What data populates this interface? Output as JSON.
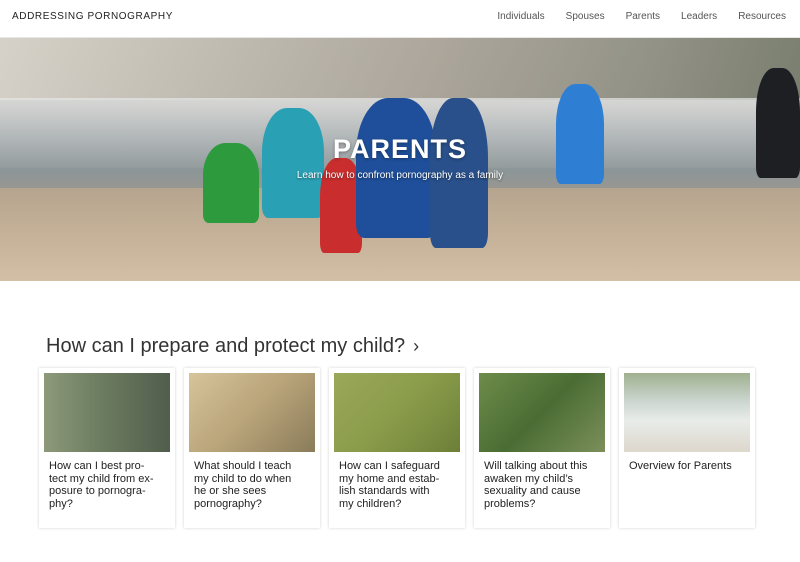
{
  "header": {
    "brand": "ADDRESSING PORNOGRAPHY",
    "nav": [
      "Individuals",
      "Spouses",
      "Parents",
      "Leaders",
      "Resources"
    ]
  },
  "hero": {
    "title": "PARENTS",
    "subtitle": "Learn how to confront pornography as a family"
  },
  "section": {
    "title": "How can I prepare and protect my child?"
  },
  "cards": [
    {
      "caption": "How can I best pro-\ntect my child from ex-\nposure to pornogra-\nphy?"
    },
    {
      "caption": "What should I teach\nmy child to do when\nhe or she sees\npornography?"
    },
    {
      "caption": "How can I safeguard\nmy home and estab-\nlish standards with\nmy children?"
    },
    {
      "caption": "Will talking about this\nawaken my child’s\nsexuality and cause\nproblems?"
    },
    {
      "caption": "Overview for Parents"
    }
  ]
}
